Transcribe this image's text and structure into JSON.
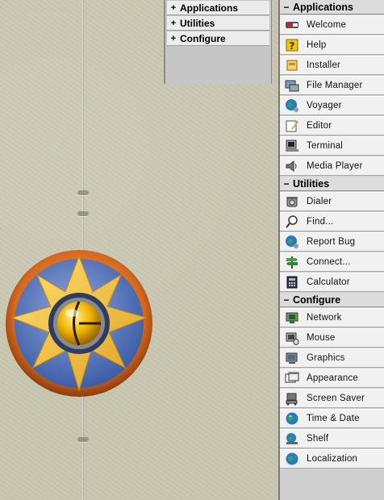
{
  "mini_panel": {
    "rows": [
      {
        "toggle": "+",
        "label": "Applications"
      },
      {
        "toggle": "+",
        "label": "Utilities"
      },
      {
        "toggle": "+",
        "label": "Configure"
      }
    ]
  },
  "deskbar": {
    "groups": [
      {
        "toggle": "−",
        "title": "Applications",
        "items": [
          {
            "label": "Welcome",
            "icon": "welcome-icon"
          },
          {
            "label": "Help",
            "icon": "help-icon"
          },
          {
            "label": "Installer",
            "icon": "installer-icon"
          },
          {
            "label": "File Manager",
            "icon": "file-manager-icon"
          },
          {
            "label": "Voyager",
            "icon": "voyager-icon"
          },
          {
            "label": "Editor",
            "icon": "editor-icon"
          },
          {
            "label": "Terminal",
            "icon": "terminal-icon"
          },
          {
            "label": "Media Player",
            "icon": "media-player-icon"
          }
        ]
      },
      {
        "toggle": "−",
        "title": "Utilities",
        "items": [
          {
            "label": "Dialer",
            "icon": "dialer-icon"
          },
          {
            "label": "Find...",
            "icon": "find-icon"
          },
          {
            "label": "Report Bug",
            "icon": "report-bug-icon"
          },
          {
            "label": "Connect...",
            "icon": "connect-icon"
          },
          {
            "label": "Calculator",
            "icon": "calculator-icon"
          }
        ]
      },
      {
        "toggle": "−",
        "title": "Configure",
        "items": [
          {
            "label": "Network",
            "icon": "network-icon"
          },
          {
            "label": "Mouse",
            "icon": "mouse-icon"
          },
          {
            "label": "Graphics",
            "icon": "graphics-icon"
          },
          {
            "label": "Appearance",
            "icon": "appearance-icon"
          },
          {
            "label": "Screen Saver",
            "icon": "screen-saver-icon"
          },
          {
            "label": "Time & Date",
            "icon": "time-date-icon"
          },
          {
            "label": "Shelf",
            "icon": "shelf-icon"
          },
          {
            "label": "Localization",
            "icon": "localization-icon"
          }
        ]
      }
    ]
  }
}
